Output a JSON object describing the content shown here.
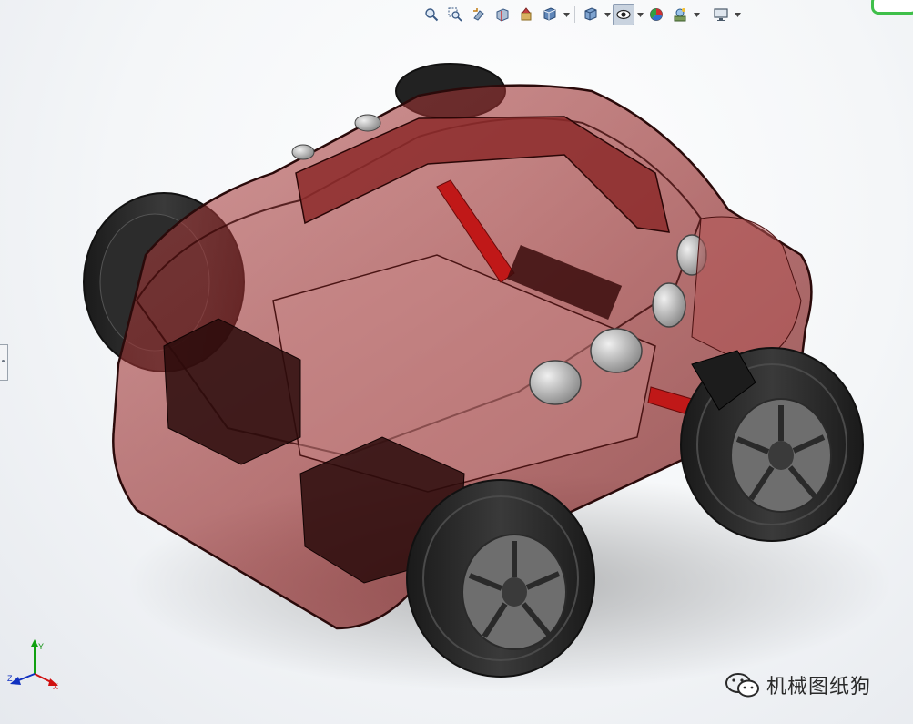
{
  "toolbar": {
    "items": [
      {
        "name": "zoom-to-fit-icon",
        "active": false
      },
      {
        "name": "zoom-to-area-icon",
        "active": false
      },
      {
        "name": "previous-view-icon",
        "active": false
      },
      {
        "name": "section-view-icon",
        "active": false
      },
      {
        "name": "dynamic-annotation-icon",
        "active": false
      },
      {
        "name": "view-orientation-icon",
        "active": false,
        "dropdown": true
      },
      {
        "name": "display-style-icon",
        "active": false,
        "dropdown": true
      },
      {
        "name": "hide-show-items-icon",
        "active": true,
        "dropdown": true
      },
      {
        "name": "edit-appearance-icon",
        "active": false
      },
      {
        "name": "apply-scene-icon",
        "active": false,
        "dropdown": true
      },
      {
        "name": "view-settings-icon",
        "active": false,
        "dropdown": true
      }
    ]
  },
  "triad": {
    "x": "X",
    "y": "Y",
    "z": "Z"
  },
  "watermark": {
    "text": "机械图纸狗"
  },
  "colors": {
    "body_shell": "#8a1c1c",
    "tire": "#2a2a2a",
    "rim": "#6e6e6e",
    "sensor": "#c8c8c8",
    "accent_red": "#c01818"
  }
}
